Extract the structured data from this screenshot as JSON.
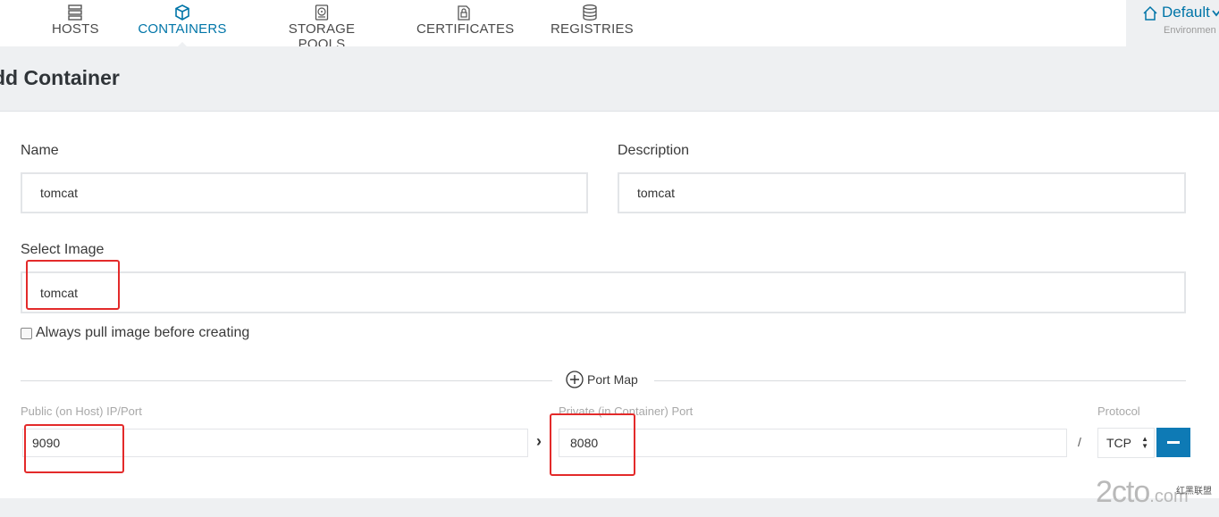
{
  "nav": {
    "items": [
      {
        "label": "HOSTS",
        "icon": "hosts-icon"
      },
      {
        "label": "CONTAINERS",
        "icon": "containers-icon",
        "active": true
      },
      {
        "label": "STORAGE POOLS",
        "icon": "storage-pools-icon"
      },
      {
        "label": "CERTIFICATES",
        "icon": "certificates-icon"
      },
      {
        "label": "REGISTRIES",
        "icon": "registries-icon"
      }
    ],
    "environment": {
      "name": "Default",
      "sub": "Environmen",
      "icon": "home-icon"
    }
  },
  "page": {
    "title": "dd Container"
  },
  "form": {
    "name": {
      "label": "Name",
      "value": "tomcat"
    },
    "description": {
      "label": "Description",
      "value": "tomcat"
    },
    "image": {
      "label": "Select Image",
      "value": "tomcat"
    },
    "always_pull": {
      "label": "Always pull image before creating",
      "checked": false
    },
    "port_map": {
      "title": "Port Map",
      "public_label": "Public (on Host) IP/Port",
      "private_label": "Private (in Container) Port",
      "protocol_label": "Protocol",
      "public_value": "9090",
      "private_value": "8080",
      "protocol_value": "TCP",
      "separator": "/",
      "arrow": "›"
    }
  },
  "watermark": {
    "main": "2cto",
    "suffix": ".com",
    "small": "红黑联盟"
  },
  "colors": {
    "accent": "#0075a8",
    "highlight": "#e32a2a",
    "band": "#eef0f2"
  }
}
